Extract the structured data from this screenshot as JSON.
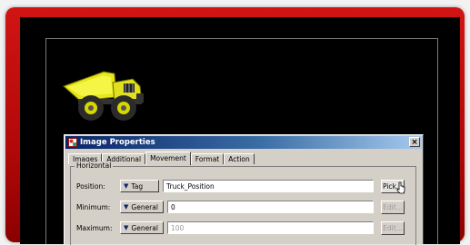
{
  "dialog": {
    "title": "Image Properties",
    "close_label": "×",
    "tabs": [
      {
        "label": "Images",
        "active": false
      },
      {
        "label": "Additional",
        "active": false
      },
      {
        "label": "Movement",
        "active": true
      },
      {
        "label": "Format",
        "active": false
      },
      {
        "label": "Action",
        "active": false
      }
    ],
    "group_label": "Horizontal",
    "rows": [
      {
        "label": "Position:",
        "type": "Tag",
        "value": "Truck_Position",
        "button": "Pick...",
        "enabled": true
      },
      {
        "label": "Minimum:",
        "type": "General",
        "value": "0",
        "button": "Edit...",
        "enabled": false
      },
      {
        "label": "Maximum:",
        "type": "General",
        "value": "100",
        "button": "Edit...",
        "enabled": false
      }
    ]
  },
  "colors": {
    "frame_red": "#c40f0f",
    "canvas_black": "#000000",
    "dialog_gray": "#d4d0c8",
    "title_blue": "#0a246a",
    "truck_yellow": "#e6e600"
  },
  "icons": [
    "dump-truck-image",
    "image-properties-icon",
    "close-icon",
    "dropdown-arrow-icon",
    "mouse-pointer-icon"
  ]
}
